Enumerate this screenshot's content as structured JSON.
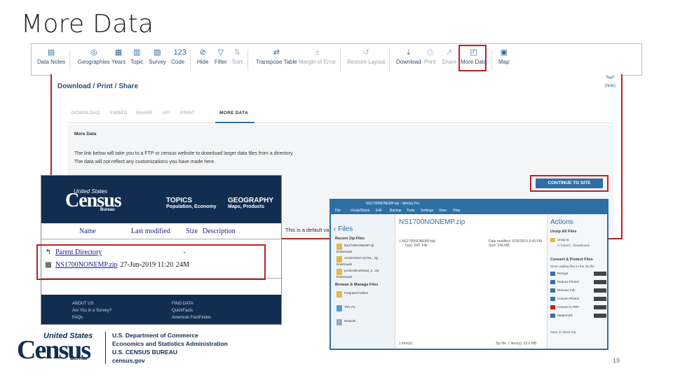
{
  "slide_title": "More Data",
  "toolbar": {
    "items": [
      "Data Notes",
      "Geographies",
      "Years",
      "Topic",
      "Survey",
      "Code",
      "Hide",
      "Filter",
      "Sort",
      "Transpose Table",
      "Margin of Error",
      "Restore Layout",
      "Download",
      "Print",
      "Share",
      "More Data",
      "Map"
    ]
  },
  "panel": {
    "title": "Download / Print / Share",
    "chevron_label": "(hide)",
    "tabs": [
      "DOWNLOAD",
      "EMBED",
      "SHARE",
      "API",
      "PRINT",
      "MORE DATA"
    ],
    "heading": "More Data",
    "line1": "The link below will take you to a FTP or census website to download larger data files from a directory.",
    "line2": "The data will not reflect any customizations you have made here.",
    "continue_button": "CONTINUE TO SITE",
    "default_note": "This is a default va"
  },
  "ftp": {
    "logo_top": "United States",
    "logo": "Census",
    "logo_sub": "Bureau",
    "nav": [
      {
        "title": "TOPICS",
        "sub": "Population, Economy"
      },
      {
        "title": "GEOGRAPHY",
        "sub": "Maps, Products"
      }
    ],
    "columns": [
      "Name",
      "Last modified",
      "Size",
      "Description"
    ],
    "parent_dir": "Parent Directory",
    "parent_size": "-",
    "file_name": "NS1700NONEMP.zip",
    "file_date": "27-Jun-2019 11:20",
    "file_size": "24M",
    "footer_cols": [
      {
        "head": "ABOUT US",
        "a": "Are You in a Survey?",
        "b": "FAQs"
      },
      {
        "head": "FIND DATA",
        "a": "QuickFacts",
        "b": "American FactFinder"
      }
    ]
  },
  "winzip": {
    "title": "NS1700NONEMP.zip - WinZip Pro",
    "menu": [
      "File",
      "Unzip/Share",
      "Edit",
      "Backup",
      "Tools",
      "Settings",
      "View",
      "Help"
    ],
    "files_header": "Files",
    "recent_label": "Recent Zip Files",
    "recent": [
      {
        "name": "NS1700NONEMP.zip",
        "path": "Downloads"
      },
      {
        "name": "ACS5Y2017.S1701...zip",
        "path": "Downloads"
      },
      {
        "name": "productDownload_2...zip",
        "path": "Downloads"
      }
    ],
    "browse_label": "Browse & Manage Files",
    "browse": [
      "Frequent Folders",
      "This PC",
      "Network"
    ],
    "zip_header": "NS1700NONEMP.zip",
    "file_row": "NS1700NONEMP.dat",
    "file_type": "Type: DAT File",
    "file_date": "Date modified: 6/26/2019 3:49 PM",
    "file_size": "Size: 246 MB",
    "items_count": "1 item(s)",
    "zip_info": "Zip file: 1 item(s), 23.9 MB",
    "actions_header": "Actions",
    "unzip_all": "Unzip All Files",
    "unzip_to": "Unzip to",
    "unzip_path": "C:\\Users\\...\\Downloads",
    "convert_label": "Convert & Protect Files",
    "convert_sub": "When adding files to the Zip file:",
    "convert_items": [
      "Encrypt",
      "Reduce Photos",
      "Remove Info",
      "Convert Photos",
      "Convert to PDF",
      "Watermark"
    ],
    "save_share": "Save or Share Zip"
  },
  "footer": {
    "logo_us": "United States",
    "logo_census": "Census",
    "logo_bureau": "Bureau",
    "dept1": "U.S. Department of Commerce",
    "dept2": "Economics and Statistics Administration",
    "dept3": "U.S. CENSUS BUREAU",
    "dept4": "census.gov",
    "page_number": "19"
  },
  "colors": {
    "highlight": "#c02025",
    "brand_navy": "#112e51",
    "accent_blue": "#2f6fa4"
  }
}
